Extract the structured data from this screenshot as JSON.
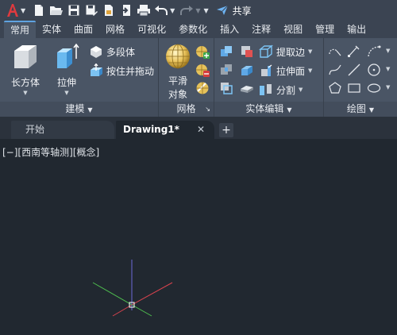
{
  "quick_access": {
    "share_label": "共享",
    "icons": [
      "app-logo-icon",
      "new-icon",
      "open-icon",
      "save-icon",
      "save-as-icon",
      "publish-icon",
      "plot-icon",
      "print-icon",
      "undo-icon",
      "redo-icon",
      "customize-icon",
      "share-icon"
    ]
  },
  "ribbon_tabs": [
    "常用",
    "实体",
    "曲面",
    "网格",
    "可视化",
    "参数化",
    "插入",
    "注释",
    "视图",
    "管理",
    "输出"
  ],
  "active_tab": "常用",
  "panels": {
    "modeling": {
      "title": "建模",
      "box": "长方体",
      "extrude": "拉伸",
      "polysolid": "多段体",
      "presspull": "按住并拖动"
    },
    "mesh": {
      "title": "网格",
      "smooth_line1": "平滑",
      "smooth_line2": "对象"
    },
    "solid_editing": {
      "title": "实体编辑",
      "extract_edges": "提取边",
      "extrude_faces": "拉伸面",
      "separate": "分割"
    },
    "draw": {
      "title": "绘图"
    }
  },
  "document_tabs": {
    "start": "开始",
    "drawing": "Drawing1*",
    "close": "✕",
    "new": "+"
  },
  "viewport": {
    "label": "[−][西南等轴测][概念]"
  },
  "colors": {
    "accent": "#5fa3e0",
    "ucs_x": "#d9434e",
    "ucs_y": "#4fbf4f",
    "ucs_z": "#6c6ad8"
  }
}
